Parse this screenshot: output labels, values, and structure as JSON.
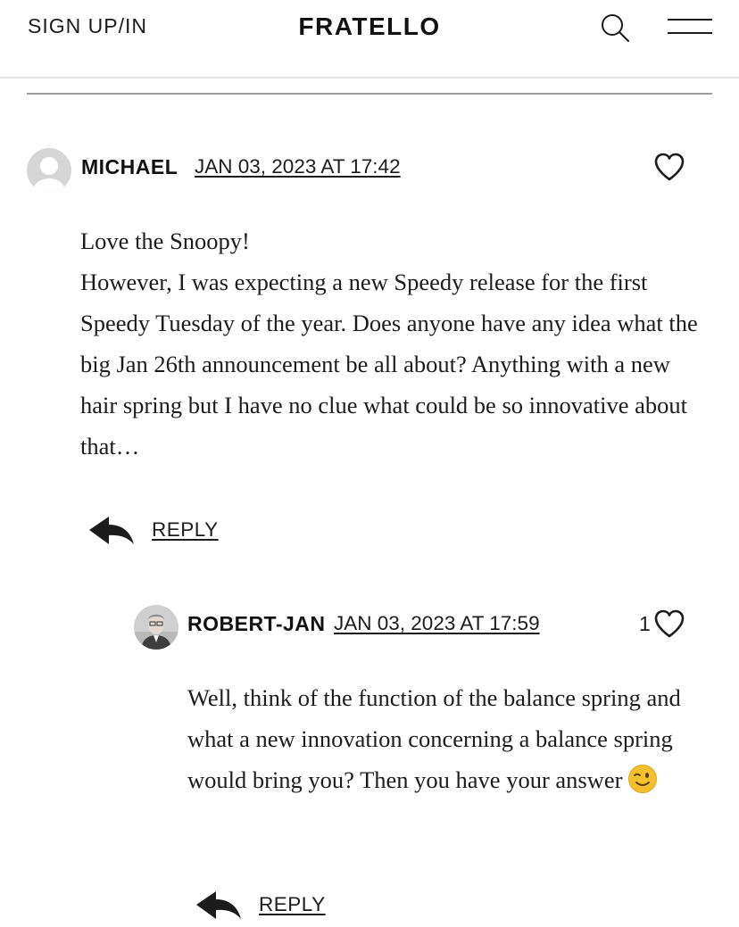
{
  "header": {
    "signin_label": "SIGN UP/IN",
    "logo": "FRATELLO",
    "search_icon": "search-icon",
    "menu_icon": "hamburger-menu-icon"
  },
  "comments": [
    {
      "author": "MICHAEL",
      "date": "JAN 03, 2023 AT 17:42",
      "avatar": "default-avatar",
      "likes": "",
      "body": [
        "Love the Snoopy!",
        "However, I was expecting a new Speedy release for the first Speedy Tuesday of the year. Does anyone have any idea what the big Jan 26th announcement be all about? Anything with a new hair spring but I have no clue what could be so innovative about that…"
      ],
      "reply_label": "REPLY"
    },
    {
      "author": "ROBERT-JAN",
      "date": "JAN 03, 2023 AT 17:59",
      "avatar": "user-photo-avatar",
      "likes": "1",
      "body": [
        "Well, think of the function of the balance spring and what a new innovation concerning a balance spring would bring you? Then you have your answer"
      ],
      "emoji": "winking-face-emoji",
      "reply_label": "REPLY"
    }
  ],
  "colors": {
    "text": "#1c1c1c",
    "divider": "#9d9d9d",
    "emoji": "#f5c02e"
  }
}
